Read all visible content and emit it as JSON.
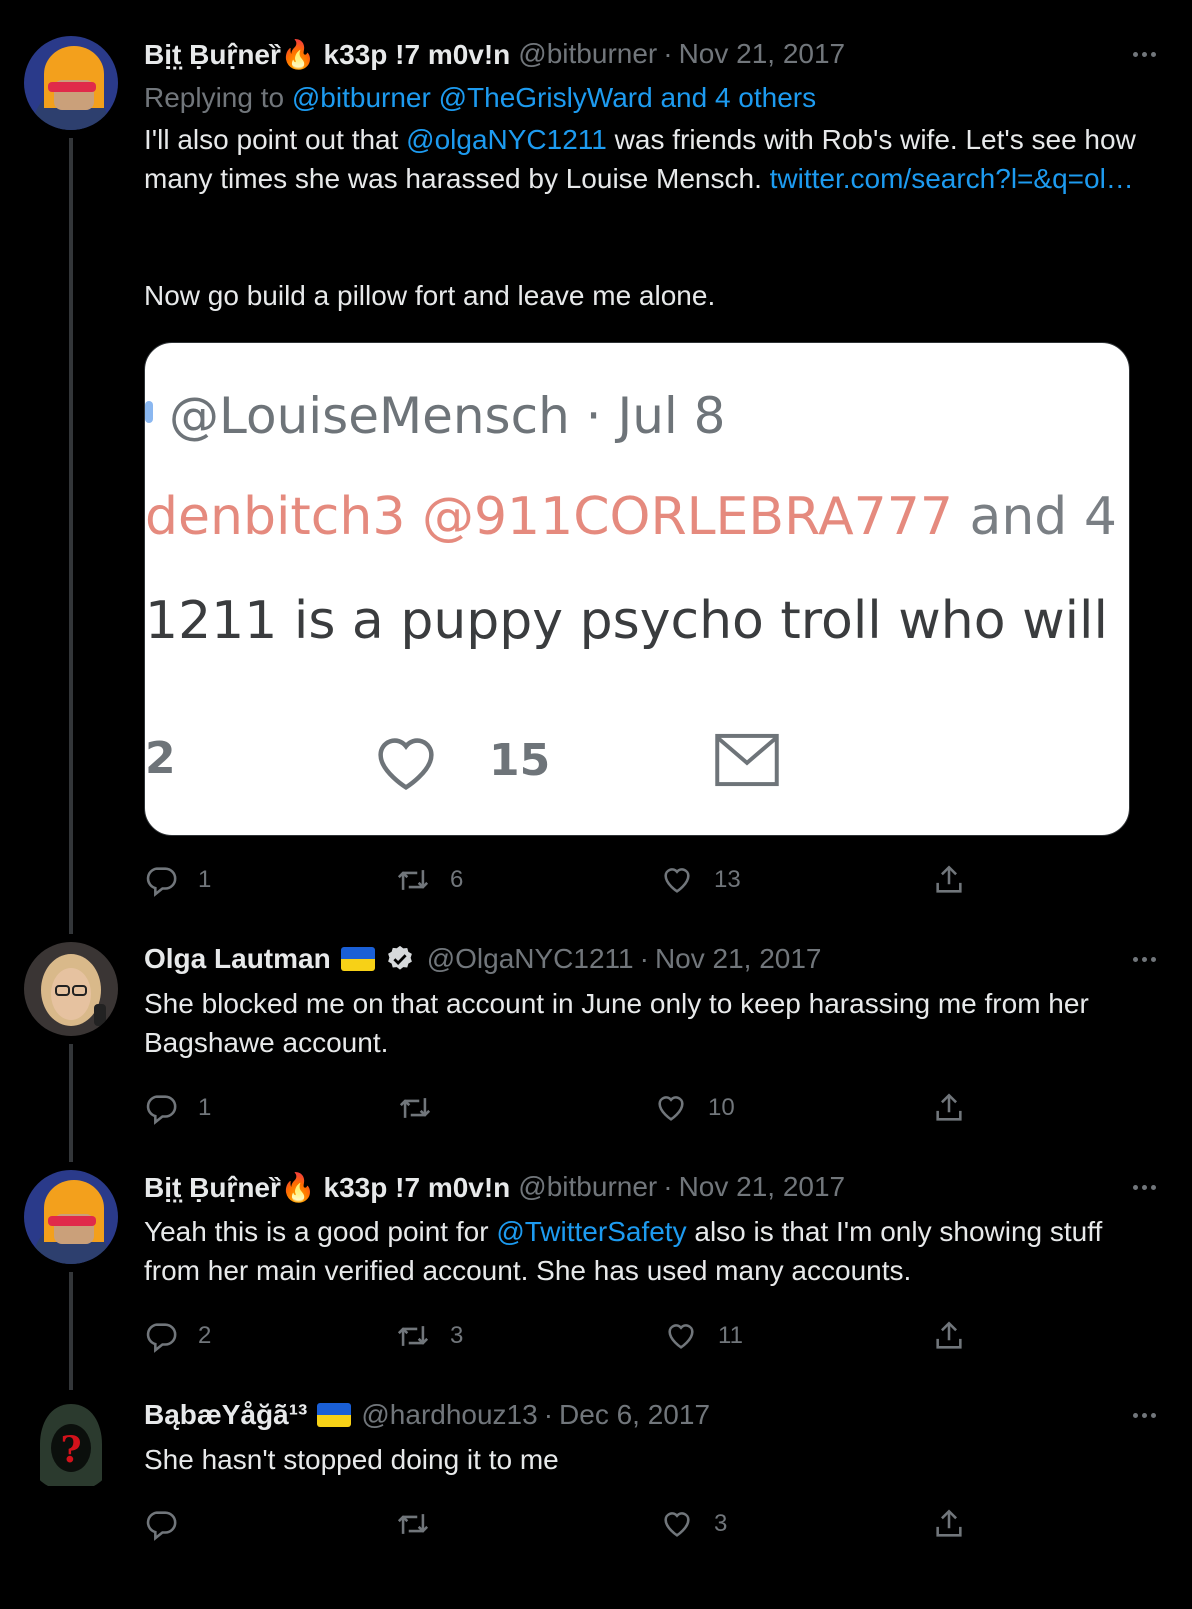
{
  "tweets": [
    {
      "display_name": "Bịt̤ Ḅuṛ̂neȑ🔥 k33p !7 m0v!n",
      "handle": "@bitburner",
      "date": "Nov 21, 2017",
      "replying_prefix": "Replying to ",
      "replying_users": "@bitburner @TheGrislyWard and 4 others",
      "text_1": "I'll also point out that ",
      "mention_1": "@olgaNYC1211",
      "text_2": " was friends with Rob's wife. Let's see how many times she was harassed by Louise Mensch. ",
      "link": "twitter.com/search?l=&q=ol…",
      "text_3": "Now go build a pillow fort and leave me alone.",
      "replies": "1",
      "retweets": "6",
      "likes": "13"
    },
    {
      "display_name": "Olga Lautman",
      "handle": "@OlgaNYC1211",
      "date": "Nov 21, 2017",
      "text_1": "She blocked me on that account in June only to keep harassing me from her Bagshawe account.",
      "replies": "1",
      "retweets": "",
      "likes": "10"
    },
    {
      "display_name": "Bịt̤ Ḅuṛ̂neȑ🔥 k33p !7 m0v!n",
      "handle": "@bitburner",
      "date": "Nov 21, 2017",
      "text_1": "Yeah this is a good point for ",
      "mention_1": "@TwitterSafety",
      "text_2": " also is that I'm only showing stuff from her main verified account. She has used many accounts.",
      "replies": "2",
      "retweets": "3",
      "likes": "11"
    },
    {
      "display_name": "BąbæYåğã¹³",
      "handle": "@hardhouz13",
      "date": "Dec 6, 2017",
      "text_1": "She hasn't stopped doing it to me",
      "replies": "",
      "retweets": "",
      "likes": "3"
    }
  ],
  "media": {
    "handle_line": "@LouiseMensch · Jul 8",
    "reply_red": "denbitch3 @911CORLEBRA777",
    "reply_gray": " and 4",
    "text": "1211 is a puppy psycho troll who will",
    "retweet_count": "2",
    "like_count": "15"
  },
  "colors": {
    "background": "#000000",
    "text": "#e7e9ea",
    "secondary": "#71767b",
    "link": "#1d9bf0"
  },
  "icons": [
    "reply-icon",
    "retweet-icon",
    "like-icon",
    "share-icon",
    "more-icon",
    "verified-icon"
  ]
}
